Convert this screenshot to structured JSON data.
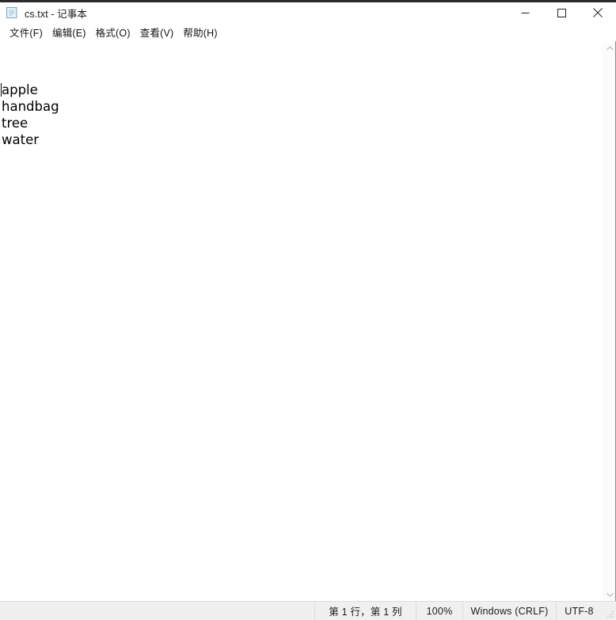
{
  "window": {
    "title": "cs.txt - 记事本",
    "app_icon": "notepad-icon",
    "controls": {
      "minimize": "minimize-icon",
      "maximize": "maximize-icon",
      "close": "close-icon"
    }
  },
  "menubar": {
    "items": [
      {
        "label": "文件(F)"
      },
      {
        "label": "编辑(E)"
      },
      {
        "label": "格式(O)"
      },
      {
        "label": "查看(V)"
      },
      {
        "label": "帮助(H)"
      }
    ]
  },
  "editor": {
    "lines": [
      "apple",
      "handbag",
      "tree",
      "water"
    ],
    "caret_line": 1,
    "caret_column": 1
  },
  "scrollbar": {
    "up_arrow": "chevron-up-icon",
    "down_arrow": "chevron-down-icon"
  },
  "statusbar": {
    "line_col": "第 1 行，第 1 列",
    "zoom": "100%",
    "line_ending": "Windows (CRLF)",
    "encoding": "UTF-8",
    "grip": "resize-grip-icon"
  },
  "colors": {
    "window_bg": "#ffffff",
    "statusbar_bg": "#f0f0f0",
    "statusbar_border": "#dcdcdc",
    "text": "#000000",
    "scrollbar_bg": "#fbfbfb",
    "top_edge": "#2b2b2e"
  }
}
